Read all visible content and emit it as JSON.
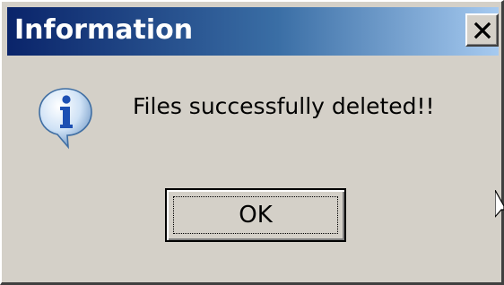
{
  "dialog": {
    "title": "Information",
    "message": "Files successfully deleted!!",
    "icon": "info-icon",
    "ok_label": "OK"
  },
  "colors": {
    "titlebar_start": "#0a246a",
    "titlebar_end": "#a6caf0",
    "face": "#d4d0c8"
  }
}
